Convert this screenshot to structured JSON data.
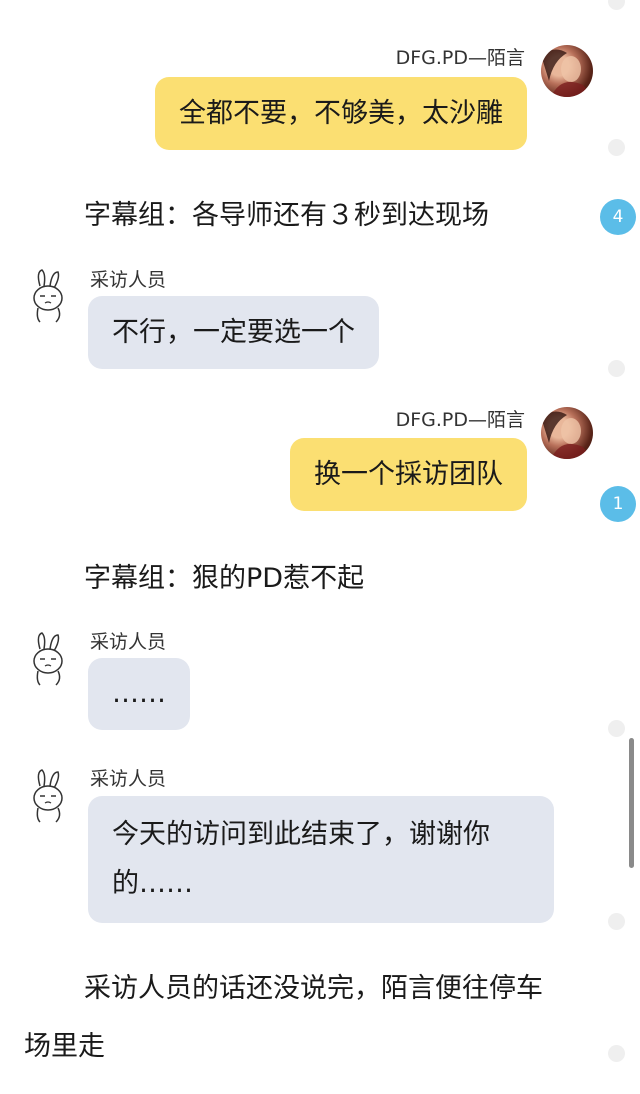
{
  "messages": [
    {
      "type": "right",
      "sender": "DFG.PD—陌言",
      "text": "全都不要，不够美，太沙雕"
    },
    {
      "type": "narration",
      "text": "字幕组：各导师还有３秒到达现场"
    },
    {
      "type": "left",
      "sender": "采访人员",
      "text": "不行，一定要选一个"
    },
    {
      "type": "right",
      "sender": "DFG.PD—陌言",
      "text": "换一个採访团队"
    },
    {
      "type": "narration",
      "text": "字幕组：狠的PD惹不起"
    },
    {
      "type": "left",
      "sender": "采访人员",
      "text": "……"
    },
    {
      "type": "left",
      "sender": "采访人员",
      "text_line1": "今天的访问到此结束了，谢谢你",
      "text_line2": "的……"
    },
    {
      "type": "narration",
      "text_line1": "采访人员的话还没说完，陌言便往停车",
      "text_line2": "场里走"
    }
  ],
  "badges": [
    "4",
    "1"
  ],
  "icons": {
    "right_avatar": "user-photo-avatar",
    "left_avatar": "bunny-sticker-avatar"
  },
  "colors": {
    "right_bubble": "#fbdf72",
    "left_bubble": "#e2e6ef",
    "badge": "#5bbde8",
    "scrollbar": "#8a8a8a"
  }
}
